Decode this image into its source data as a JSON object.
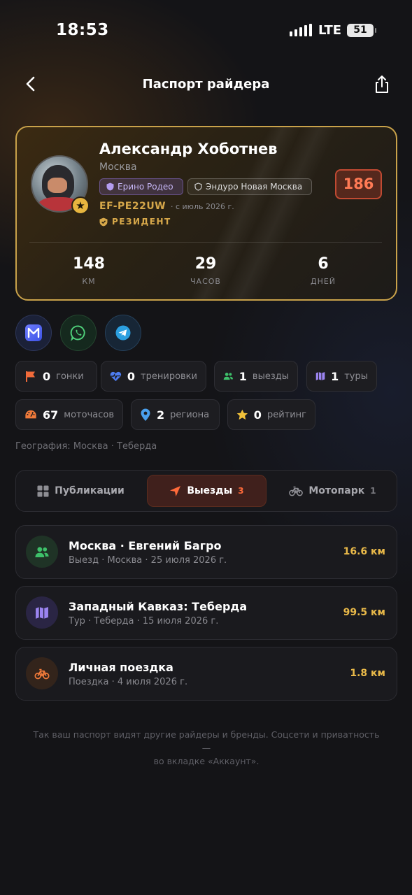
{
  "status_bar": {
    "time": "18:53",
    "network": "LTE",
    "battery": "51"
  },
  "header": {
    "title": "Паспорт райдера"
  },
  "profile": {
    "name": "Александр Хоботнев",
    "city": "Москва",
    "chips": [
      "Ерино Родео",
      "Эндуро Новая Москва"
    ],
    "score": "186",
    "code": "EF-PE22UW",
    "since": "· с июль 2026 г.",
    "status": "РЕЗИДЕНТ",
    "stats": [
      {
        "value": "148",
        "label": "КМ"
      },
      {
        "value": "29",
        "label": "ЧАСОВ"
      },
      {
        "value": "6",
        "label": "ДНЕЙ"
      }
    ]
  },
  "socials": [
    "max-icon",
    "whatsapp-icon",
    "telegram-icon"
  ],
  "activity": [
    {
      "value": "0",
      "label": "гонки",
      "icon": "flag-icon"
    },
    {
      "value": "0",
      "label": "тренировки",
      "icon": "heart-pulse-icon"
    },
    {
      "value": "1",
      "label": "выезды",
      "icon": "users-icon"
    },
    {
      "value": "1",
      "label": "туры",
      "icon": "map-icon"
    },
    {
      "value": "67",
      "label": "моточасов",
      "icon": "speedometer-icon"
    },
    {
      "value": "2",
      "label": "региона",
      "icon": "pin-icon"
    },
    {
      "value": "0",
      "label": "рейтинг",
      "icon": "star-icon"
    }
  ],
  "geography": "География: Москва · Теберда",
  "tabs": [
    {
      "label": "Публикации",
      "count": ""
    },
    {
      "label": "Выезды",
      "count": "3"
    },
    {
      "label": "Мотопарк",
      "count": "1"
    }
  ],
  "rides": [
    {
      "title": "Москва · Евгений Багро",
      "subtitle": "Выезд · Москва · 25 июля 2026 г.",
      "distance": "16.6 км",
      "icon": "users-icon"
    },
    {
      "title": "Западный Кавказ: Теберда",
      "subtitle": "Тур · Теберда · 15 июля 2026 г.",
      "distance": "99.5 км",
      "icon": "map-icon"
    },
    {
      "title": "Личная поездка",
      "subtitle": "Поездка · 4 июля 2026 г.",
      "distance": "1.8 км",
      "icon": "bicycle-icon"
    }
  ],
  "footer": {
    "line1": "Так ваш паспорт видят другие райдеры и бренды. Соцсети и приватность —",
    "line2": "во вкладке «Аккаунт»."
  },
  "colors": {
    "gold": "#d7a84a",
    "accent_orange": "#ff7a55",
    "distance": "#e9b949"
  }
}
